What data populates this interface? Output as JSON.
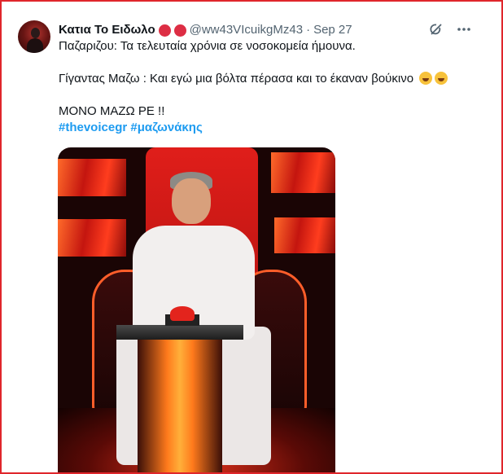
{
  "tweet": {
    "author_name": "Κατια Το Ειδωλο",
    "handle": "@ww43VIcuikgMz43",
    "separator": "·",
    "date": "Sep 27",
    "lines": [
      "Παζαριζου: Τα τελευταία χρόνια σε νοσοκομεία ήμουνα.",
      "Γίγαντας Μαζω : Και εγώ μια βόλτα πέρασα και το έκαναν βούκινο",
      "ΜΟΝΟ ΜΑΖΩ ΡΕ !!"
    ],
    "hashtags": [
      "#thevoicegr",
      "#μαζωνάκης"
    ],
    "emojis": [
      "rolling-on-floor-laughing-emoji",
      "rolling-on-floor-laughing-emoji"
    ],
    "badges": [
      "red-circle",
      "red-circle"
    ],
    "media": {
      "description_icon": "photo"
    }
  },
  "colors": {
    "link": "#1d9bf0",
    "secondary_text": "#536471",
    "frame_border": "#e0262b",
    "badge": "#dd2e44"
  }
}
